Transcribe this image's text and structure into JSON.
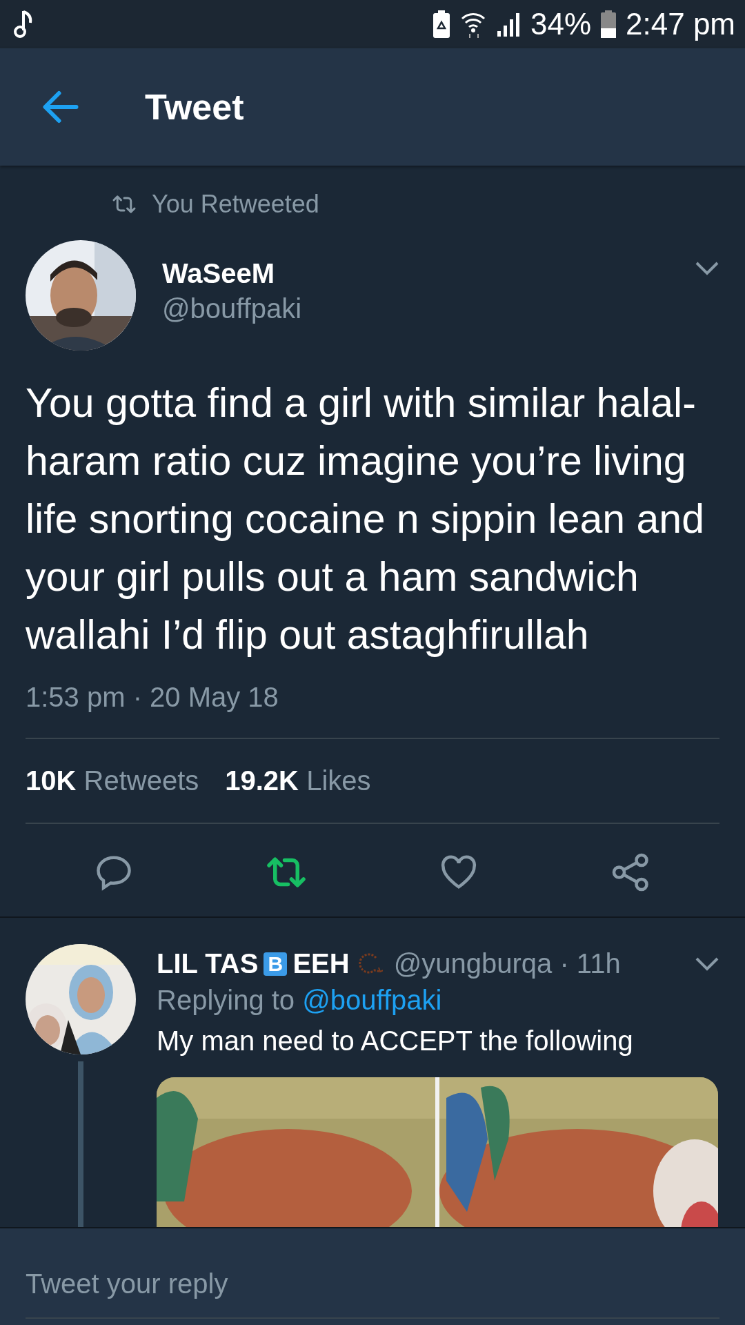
{
  "status_bar": {
    "battery_percent": "34%",
    "time": "2:47 pm"
  },
  "header": {
    "title": "Tweet"
  },
  "retweet_context": "You Retweeted",
  "tweet": {
    "name": "WaSeeM",
    "handle": "@bouffpaki",
    "text": "You gotta find a girl with similar halal-haram ratio cuz imagine you’re living life snorting cocaine n sippin lean and your girl pulls out a ham sandwich wallahi I’d flip out astaghfirullah",
    "timestamp": "1:53 pm · 20 May 18",
    "stats": [
      {
        "count": "10K",
        "label": "Retweets"
      },
      {
        "count": "19.2K",
        "label": "Likes"
      }
    ],
    "actions": [
      {
        "kind": "reply",
        "active": false
      },
      {
        "kind": "retweet",
        "active": true
      },
      {
        "kind": "like",
        "active": false
      },
      {
        "kind": "share",
        "active": false
      }
    ]
  },
  "reply": {
    "name_start": "LIL TAS",
    "name_badge": "B",
    "name_end": "EEH",
    "handle": "@yungburqa",
    "time": "· 11h",
    "replying_label": "Replying to",
    "replying_to": "@bouffpaki",
    "text": "My man need to ACCEPT the following"
  },
  "composer": {
    "placeholder": "Tweet your reply"
  }
}
